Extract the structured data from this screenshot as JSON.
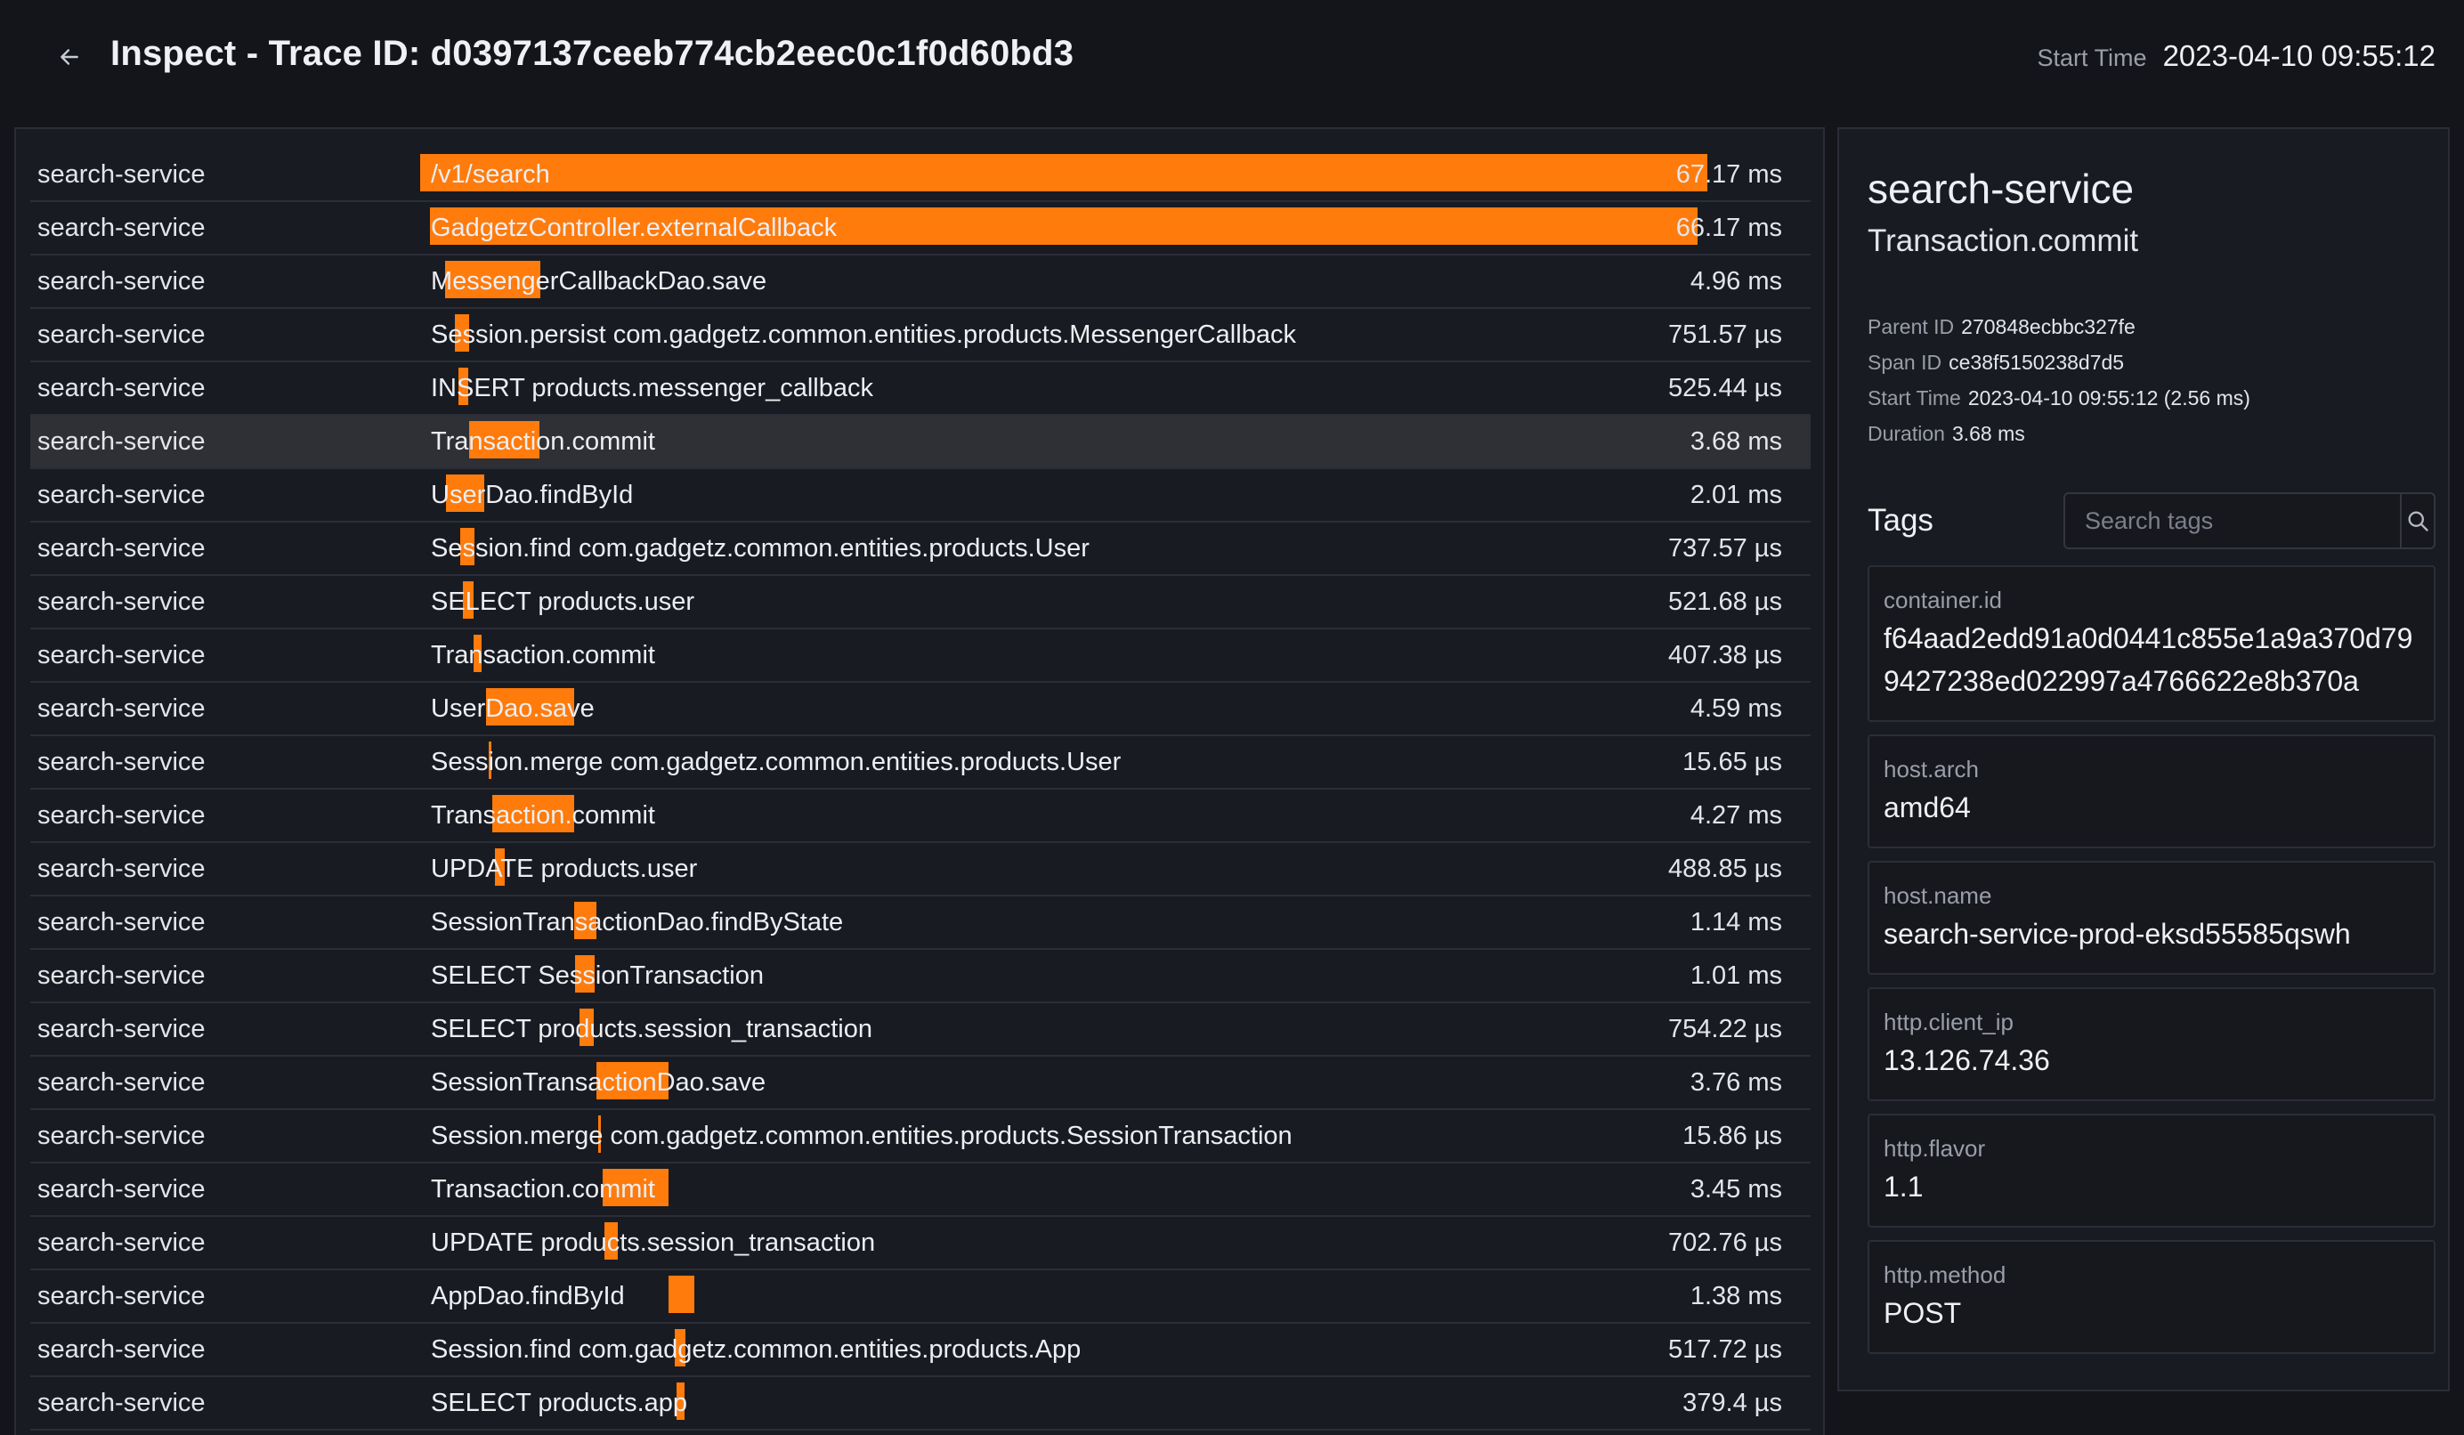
{
  "header": {
    "title": "Inspect - Trace ID: d0397137ceeb774cb2eec0c1f0d60bd3",
    "start_time_label": "Start Time",
    "start_time_value": "2023-04-10 09:55:12"
  },
  "colors": {
    "accent": "#ff7b0c",
    "background": "#13151b",
    "panel": "#191b22"
  },
  "trace": {
    "total_duration_ms": 67.17,
    "spans": [
      {
        "service": "search-service",
        "name": "/v1/search",
        "duration": "67.17 ms",
        "offset_ms": 0,
        "dur_ms": 67.17
      },
      {
        "service": "search-service",
        "name": "GadgetzController.externalCallback",
        "duration": "66.17 ms",
        "offset_ms": 0.5,
        "dur_ms": 66.17
      },
      {
        "service": "search-service",
        "name": "MessengerCallbackDao.save",
        "duration": "4.96 ms",
        "offset_ms": 1.3,
        "dur_ms": 4.96
      },
      {
        "service": "search-service",
        "name": "Session.persist com.gadgetz.common.entities.products.MessengerCallback",
        "duration": "751.57 µs",
        "offset_ms": 1.8,
        "dur_ms": 0.75
      },
      {
        "service": "search-service",
        "name": "INSERT products.messenger_callback",
        "duration": "525.44 µs",
        "offset_ms": 2.0,
        "dur_ms": 0.53
      },
      {
        "service": "search-service",
        "name": "Transaction.commit",
        "duration": "3.68 ms",
        "offset_ms": 2.56,
        "dur_ms": 3.68,
        "selected": true
      },
      {
        "service": "search-service",
        "name": "UserDao.findById",
        "duration": "2.01 ms",
        "offset_ms": 1.35,
        "dur_ms": 2.01
      },
      {
        "service": "search-service",
        "name": "Session.find com.gadgetz.common.entities.products.User",
        "duration": "737.57 µs",
        "offset_ms": 2.1,
        "dur_ms": 0.74
      },
      {
        "service": "search-service",
        "name": "SELECT products.user",
        "duration": "521.68 µs",
        "offset_ms": 2.25,
        "dur_ms": 0.52
      },
      {
        "service": "search-service",
        "name": "Transaction.commit",
        "duration": "407.38 µs",
        "offset_ms": 2.8,
        "dur_ms": 0.41
      },
      {
        "service": "search-service",
        "name": "UserDao.save",
        "duration": "4.59 ms",
        "offset_ms": 3.45,
        "dur_ms": 4.59
      },
      {
        "service": "search-service",
        "name": "Session.merge com.gadgetz.common.entities.products.User",
        "duration": "15.65 µs",
        "offset_ms": 3.6,
        "dur_ms": 0.02
      },
      {
        "service": "search-service",
        "name": "Transaction.commit",
        "duration": "4.27 ms",
        "offset_ms": 3.75,
        "dur_ms": 4.27
      },
      {
        "service": "search-service",
        "name": "UPDATE products.user",
        "duration": "488.85 µs",
        "offset_ms": 3.9,
        "dur_ms": 0.49
      },
      {
        "service": "search-service",
        "name": "SessionTransactionDao.findByState",
        "duration": "1.14 ms",
        "offset_ms": 8.05,
        "dur_ms": 1.14
      },
      {
        "service": "search-service",
        "name": "SELECT SessionTransaction",
        "duration": "1.01 ms",
        "offset_ms": 8.1,
        "dur_ms": 1.01
      },
      {
        "service": "search-service",
        "name": "SELECT products.session_transaction",
        "duration": "754.22 µs",
        "offset_ms": 8.3,
        "dur_ms": 0.75
      },
      {
        "service": "search-service",
        "name": "SessionTransactionDao.save",
        "duration": "3.76 ms",
        "offset_ms": 9.2,
        "dur_ms": 3.76
      },
      {
        "service": "search-service",
        "name": "Session.merge com.gadgetz.common.entities.products.SessionTransaction",
        "duration": "15.86 µs",
        "offset_ms": 9.3,
        "dur_ms": 0.02
      },
      {
        "service": "search-service",
        "name": "Transaction.commit",
        "duration": "3.45 ms",
        "offset_ms": 9.5,
        "dur_ms": 3.45
      },
      {
        "service": "search-service",
        "name": "UPDATE products.session_transaction",
        "duration": "702.76 µs",
        "offset_ms": 9.6,
        "dur_ms": 0.7
      },
      {
        "service": "search-service",
        "name": "AppDao.findById",
        "duration": "1.38 ms",
        "offset_ms": 12.95,
        "dur_ms": 1.38
      },
      {
        "service": "search-service",
        "name": "Session.find com.gadgetz.common.entities.products.App",
        "duration": "517.72 µs",
        "offset_ms": 13.3,
        "dur_ms": 0.52
      },
      {
        "service": "search-service",
        "name": "SELECT products.app",
        "duration": "379.4 µs",
        "offset_ms": 13.4,
        "dur_ms": 0.38
      }
    ]
  },
  "detail": {
    "service": "search-service",
    "operation": "Transaction.commit",
    "meta": [
      {
        "label": "Parent ID",
        "value": "270848ecbbc327fe"
      },
      {
        "label": "Span ID",
        "value": "ce38f5150238d7d5"
      },
      {
        "label": "Start Time",
        "value": "2023-04-10 09:55:12 (2.56 ms)"
      },
      {
        "label": "Duration",
        "value": "3.68 ms"
      }
    ],
    "tags_title": "Tags",
    "search_placeholder": "Search tags",
    "tags": [
      {
        "key": "container.id",
        "value": "f64aad2edd91a0d0441c855e1a9a370d799427238ed022997a4766622e8b370a"
      },
      {
        "key": "host.arch",
        "value": "amd64"
      },
      {
        "key": "host.name",
        "value": "search-service-prod-eksd55585qswh"
      },
      {
        "key": "http.client_ip",
        "value": "13.126.74.36"
      },
      {
        "key": "http.flavor",
        "value": "1.1"
      },
      {
        "key": "http.method",
        "value": "POST"
      }
    ]
  }
}
